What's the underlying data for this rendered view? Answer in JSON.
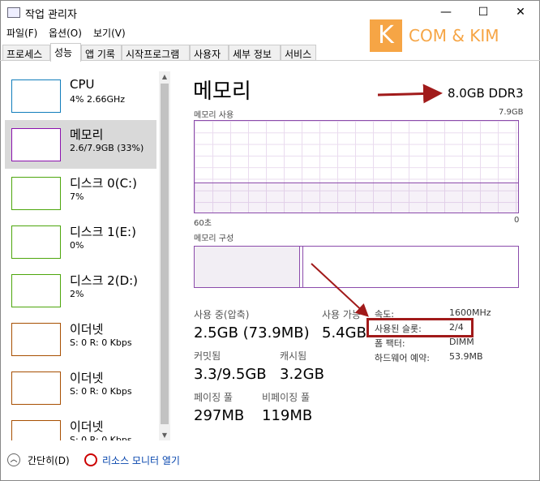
{
  "window": {
    "title": "작업 관리자",
    "minimize": "—",
    "maximize": "☐",
    "close": "✕"
  },
  "menu": [
    "파일(F)",
    "옵션(O)",
    "보기(V)"
  ],
  "tabs": [
    "프로세스",
    "성능",
    "앱 기록",
    "시작프로그램",
    "사용자",
    "세부 정보",
    "서비스"
  ],
  "active_tab": "성능",
  "watermark": {
    "k": "K",
    "text": "COM & KIM",
    "color": "#f6a545"
  },
  "sidebar": [
    {
      "name": "CPU",
      "sub": "4% 2.66GHz",
      "color": "#117dbb"
    },
    {
      "name": "메모리",
      "sub": "2.6/7.9GB (33%)",
      "color": "#8b12ae",
      "selected": true
    },
    {
      "name": "디스크 0(C:)",
      "sub": "7%",
      "color": "#4da60c"
    },
    {
      "name": "디스크 1(E:)",
      "sub": "0%",
      "color": "#4da60c"
    },
    {
      "name": "디스크 2(D:)",
      "sub": "2%",
      "color": "#4da60c"
    },
    {
      "name": "이더넷",
      "sub": "S: 0 R: 0 Kbps",
      "color": "#a74f01"
    },
    {
      "name": "이더넷",
      "sub": "S: 0 R: 0 Kbps",
      "color": "#a74f01"
    },
    {
      "name": "이더넷",
      "sub": "S: 0 R: 0 Kbps",
      "color": "#a74f01"
    }
  ],
  "main": {
    "title": "메모리",
    "spec": "8.0GB DDR3",
    "usage_label": "메모리 사용",
    "usage_max": "7.9GB",
    "time_left": "60초",
    "time_right": "0",
    "usage_fraction": 0.33,
    "composition_label": "메모리 구성",
    "stats": {
      "in_use_label": "사용 중(압축)",
      "in_use": "2.5GB (73.9MB)",
      "available_label": "사용 가능",
      "available": "5.4GB",
      "committed_label": "커밋됨",
      "committed": "3.3/9.5GB",
      "cached_label": "캐시됨",
      "cached": "3.2GB",
      "paged_label": "페이징 풀",
      "paged": "297MB",
      "nonpaged_label": "비페이징 풀",
      "nonpaged": "119MB"
    },
    "details": [
      [
        "속도:",
        "1600MHz"
      ],
      [
        "사용된 슬롯:",
        "2/4"
      ],
      [
        "폼 팩터:",
        "DIMM"
      ],
      [
        "하드웨어 예약:",
        "53.9MB"
      ]
    ]
  },
  "footer": {
    "fewer": "간단히(D)",
    "monitor": "리소스 모니터 열기"
  }
}
